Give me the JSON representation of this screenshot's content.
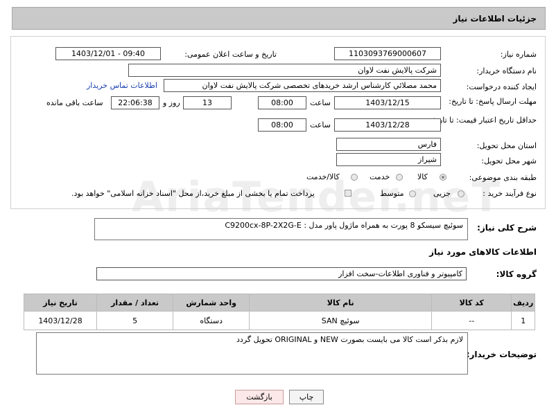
{
  "header": {
    "title": "جزئیات اطلاعات نیاز"
  },
  "form": {
    "need_number": {
      "label": "شماره نیاز:",
      "value": "1103093769000607"
    },
    "announce": {
      "label": "تاریخ و ساعت اعلان عمومی:",
      "value": "1403/12/01 - 09:40"
    },
    "buyer_org": {
      "label": "نام دستگاه خریدار:",
      "value": "شرکت پالایش نفت لاوان"
    },
    "requester": {
      "label": "ایجاد کننده درخواست:",
      "value": "محمد مصلائي کارشناس ارشد خریدهای تخصصی شرکت پالایش نفت لاوان",
      "contact_link": "اطلاعات تماس خریدار"
    },
    "reply_deadline": {
      "label": "مهلت ارسال پاسخ: تا تاریخ:",
      "date": "1403/12/15",
      "time_label": "ساعت",
      "time": "08:00",
      "days": "13",
      "days_label": "روز و",
      "remaining": "22:06:38",
      "remaining_label": "ساعت باقی مانده"
    },
    "price_validity": {
      "label": "حداقل تاریخ اعتبار قیمت: تا تاریخ:",
      "date": "1403/12/28",
      "time_label": "ساعت",
      "time": "08:00"
    },
    "province": {
      "label": "استان محل تحویل:",
      "value": "فارس"
    },
    "city": {
      "label": "شهر محل تحویل:",
      "value": "شیراز"
    },
    "category": {
      "label": "طبقه بندی موضوعی:",
      "options": [
        "کالا",
        "خدمت",
        "کالا/خدمت"
      ]
    },
    "process": {
      "label": "نوع فرآیند خرید :",
      "options": [
        "جزیی",
        "متوسط"
      ],
      "payment_note": "پرداخت تمام یا بخشی از مبلغ خرید،از محل \"اسناد خزانه اسلامی\" خواهد بود."
    }
  },
  "watermark": "AriaTender.neT",
  "summary": {
    "label": "شرح کلی نیاز:",
    "value": "سوئیچ سیسکو 8 پورت به همراه ماژول پاور مدل : C9200cx-8P-2X2G-E"
  },
  "goods_section": {
    "title": "اطلاعات کالاهای مورد نیاز"
  },
  "goods_group": {
    "label": "گروه کالا:",
    "value": "کامپیوتر و فناوری اطلاعات-سخت افزار"
  },
  "table": {
    "headers": [
      "ردیف",
      "کد کالا",
      "نام کالا",
      "واحد شمارش",
      "تعداد / مقدار",
      "تاریخ نیاز"
    ],
    "rows": [
      [
        "1",
        "--",
        "سوئیچ SAN",
        "دستگاه",
        "5",
        "1403/12/28"
      ]
    ]
  },
  "buyer_notes": {
    "label": "توضیحات خریدار:",
    "value": "لازم بذکر است کالا می بایست بصورت  NEW  و ORIGINAL تحویل گردد"
  },
  "buttons": {
    "print": "چاپ",
    "back": "بازگشت"
  }
}
